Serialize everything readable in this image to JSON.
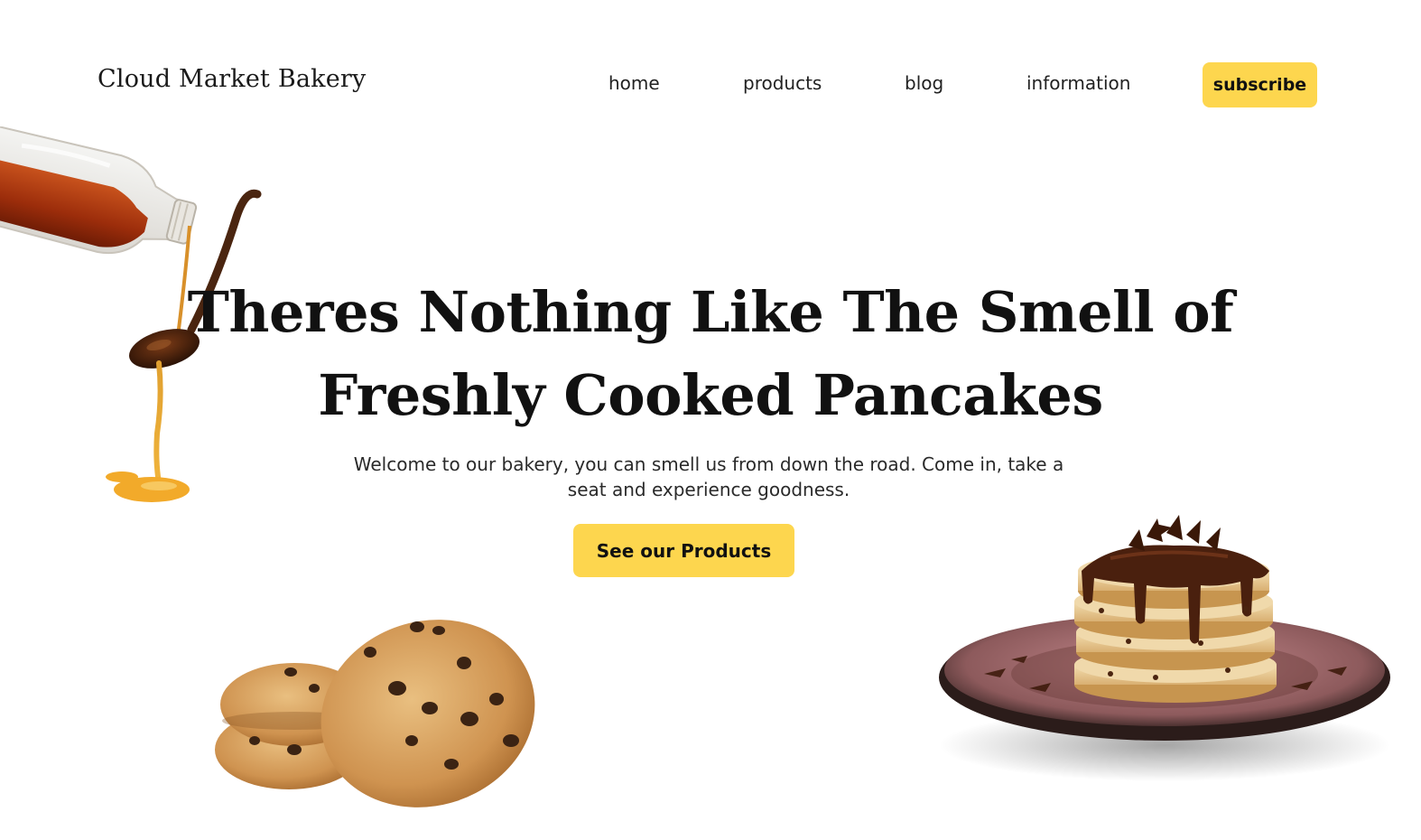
{
  "header": {
    "brand": "Cloud Market Bakery",
    "nav": [
      {
        "label": "home"
      },
      {
        "label": "products"
      },
      {
        "label": "blog"
      },
      {
        "label": "information"
      }
    ],
    "subscribe_label": "subscribe"
  },
  "hero": {
    "title": "Theres Nothing Like The Smell of Freshly Cooked Pancakes",
    "subtitle": "Welcome to our bakery, you can smell us from down the road. Come in, take a seat and experience goodness.",
    "cta_label": "See our Products"
  },
  "images": {
    "syrup": "syrup-bottle-and-spoon",
    "cookies": "chocolate-chip-cookies",
    "pancakes": "chocolate-pancake-stack"
  },
  "colors": {
    "accent": "#fdd64e",
    "text": "#111111",
    "background": "#ffffff"
  }
}
